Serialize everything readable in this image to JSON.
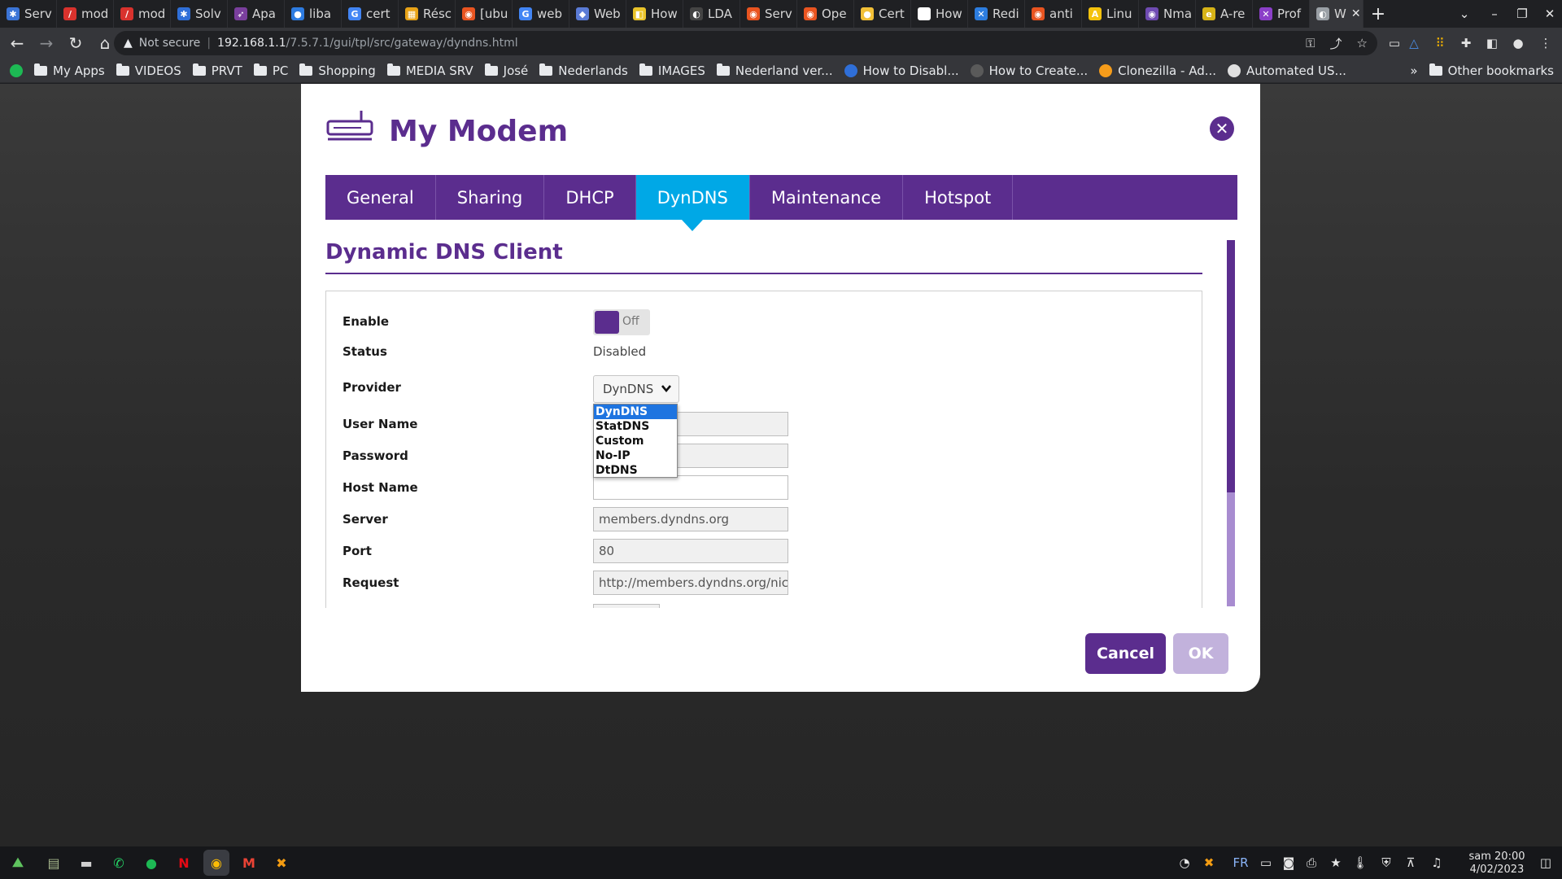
{
  "browser": {
    "tabs": [
      {
        "label": "Serv",
        "color": "#3b74d6",
        "glyph": "✱"
      },
      {
        "label": "mod",
        "color": "#d9322d",
        "glyph": "/"
      },
      {
        "label": "mod",
        "color": "#d9322d",
        "glyph": "/"
      },
      {
        "label": "Solv",
        "color": "#2f6fd8",
        "glyph": "✱"
      },
      {
        "label": "Apa",
        "color": "#7a3f9d",
        "glyph": "➶"
      },
      {
        "label": "liba",
        "color": "#2d7be0",
        "glyph": "●"
      },
      {
        "label": "cert",
        "color": "#4285f4",
        "glyph": "G"
      },
      {
        "label": "Résc",
        "color": "#e8a317",
        "glyph": "▦"
      },
      {
        "label": "[ubu",
        "color": "#e95420",
        "glyph": "◉"
      },
      {
        "label": "web",
        "color": "#4285f4",
        "glyph": "G"
      },
      {
        "label": "Web",
        "color": "#5a7bd6",
        "glyph": "◆"
      },
      {
        "label": "How",
        "color": "#e9c32a",
        "glyph": "◧"
      },
      {
        "label": "LDA",
        "color": "#444444",
        "glyph": "◐"
      },
      {
        "label": "Serv",
        "color": "#e95420",
        "glyph": "◉"
      },
      {
        "label": "Ope",
        "color": "#e95420",
        "glyph": "◉"
      },
      {
        "label": "Cert",
        "color": "#f2c037",
        "glyph": "●"
      },
      {
        "label": "How",
        "color": "#ffffff",
        "glyph": "✉"
      },
      {
        "label": "Redi",
        "color": "#2c7de0",
        "glyph": "✕"
      },
      {
        "label": "anti",
        "color": "#e95420",
        "glyph": "◉"
      },
      {
        "label": "Linu",
        "color": "#f4c20d",
        "glyph": "A"
      },
      {
        "label": "Nma",
        "color": "#6f4bb2",
        "glyph": "◉"
      },
      {
        "label": "A-re",
        "color": "#d6b317",
        "glyph": "e"
      },
      {
        "label": "Prof",
        "color": "#8b3fc8",
        "glyph": "✕"
      },
      {
        "label": "W",
        "color": "#9aa0a6",
        "glyph": "◐",
        "active": true
      }
    ],
    "new_tab_glyph": "+",
    "address": {
      "security": "Not secure",
      "host": "192.168.1.1",
      "path": "/7.5.7.1/gui/tpl/src/gateway/dyndns.html"
    },
    "bookmarks": [
      {
        "label": "My Apps",
        "type": "folder"
      },
      {
        "label": "VIDEOS",
        "type": "folder"
      },
      {
        "label": "PRVT",
        "type": "folder"
      },
      {
        "label": "PC",
        "type": "folder"
      },
      {
        "label": "Shopping",
        "type": "folder"
      },
      {
        "label": "MEDIA SRV",
        "type": "folder"
      },
      {
        "label": "José",
        "type": "folder"
      },
      {
        "label": "Nederlands",
        "type": "folder"
      },
      {
        "label": "IMAGES",
        "type": "folder"
      },
      {
        "label": "Nederland ver...",
        "type": "folder"
      },
      {
        "label": "How to Disabl...",
        "type": "link",
        "color": "#2f6fd8"
      },
      {
        "label": "How to Create...",
        "type": "link",
        "color": "#5a5a5a"
      },
      {
        "label": "Clonezilla - Ad...",
        "type": "link",
        "color": "#f59c1a"
      },
      {
        "label": "Automated US...",
        "type": "link",
        "color": "#e0e0e0"
      }
    ],
    "bookmarks_overflow": "»",
    "other_bookmarks": "Other bookmarks"
  },
  "modal": {
    "title": "My Modem",
    "tabs": [
      "General",
      "Sharing",
      "DHCP",
      "DynDNS",
      "Maintenance",
      "Hotspot"
    ],
    "active_tab": "DynDNS",
    "section_title": "Dynamic DNS Client",
    "fields": {
      "enable_label": "Enable",
      "enable_state": "Off",
      "status_label": "Status",
      "status_value": "Disabled",
      "provider_label": "Provider",
      "provider_value": "DynDNS",
      "username_label": "User Name",
      "password_label": "Password",
      "hostname_label": "Host Name",
      "server_label": "Server",
      "server_value": "members.dyndns.org",
      "port_label": "Port",
      "port_value": "80",
      "request_label": "Request",
      "request_value": "http://members.dyndns.org/nic/"
    },
    "provider_options": [
      "DynDNS",
      "StatDNS",
      "Custom",
      "No-IP",
      "DtDNS"
    ],
    "buttons": {
      "cancel": "Cancel",
      "ok": "OK"
    }
  },
  "taskbar": {
    "language": "FR",
    "clock_time": "sam 20:00",
    "clock_date": "4/02/2023"
  },
  "colors": {
    "brand_purple": "#5b2d8e",
    "active_tab_blue": "#00a8e6",
    "ok_disabled": "#c2b2dc"
  }
}
